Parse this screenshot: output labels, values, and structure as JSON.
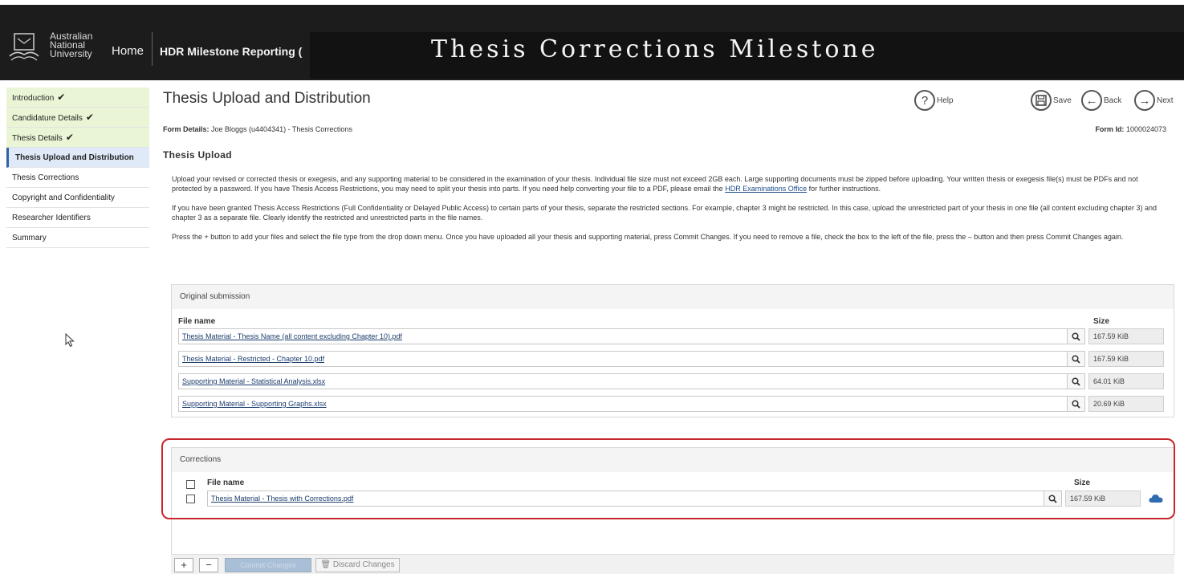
{
  "header": {
    "logo_lines": [
      "Australian",
      "National",
      "University"
    ],
    "home": "Home",
    "hdr": "HDR Milestone Reporting (",
    "banner": "Thesis Corrections Milestone"
  },
  "sidebar": {
    "items": [
      {
        "label": "Introduction",
        "status": "done"
      },
      {
        "label": "Candidature Details",
        "status": "done"
      },
      {
        "label": "Thesis Details",
        "status": "done"
      },
      {
        "label": "Thesis Upload and Distribution",
        "status": "active"
      },
      {
        "label": "Thesis Corrections",
        "status": ""
      },
      {
        "label": "Copyright and Confidentiality",
        "status": ""
      },
      {
        "label": "Researcher Identifiers",
        "status": ""
      },
      {
        "label": "Summary",
        "status": ""
      }
    ],
    "check_glyph": "✔"
  },
  "main": {
    "title": "Thesis Upload and Distribution",
    "form_details_label": "Form Details:",
    "form_details_value": " Joe Bloggs (u4404341) - Thesis Corrections",
    "form_id_label": "Form Id:",
    "form_id_value": " 1000024073",
    "section_title": "Thesis Upload",
    "toolbar": {
      "help": "Help",
      "save": "Save",
      "back": "Back",
      "next": "Next"
    },
    "para1_a": "Upload your revised or corrected thesis or exegesis, and any supporting material to be considered in the examination of your thesis. Individual file size must not exceed 2GB each. Large supporting documents must be zipped before uploading. Your written thesis or exegesis file(s) must be PDFs and not protected by a password. If you have Thesis Access Restrictions, you may need to split your thesis into parts. If you need help converting your file to a PDF, please email the ",
    "para1_link": "HDR Examinations Office",
    "para1_b": " for further instructions.",
    "para2": "If you have been granted Thesis Access Restrictions (Full Confidentiality or Delayed Public Access) to certain parts of your thesis, separate the restricted sections. For example, chapter 3 might be restricted. In this case, upload the unrestricted part of your thesis in one file (all content excluding chapter 3) and chapter 3 as a separate file. Clearly identify the restricted and unrestricted parts in the file names.",
    "para3": "Press the + button to add your files and select the file type from the drop down menu. Once you have uploaded all your thesis and supporting material, press Commit Changes. If you need to remove a file, check the box to the left of the file, press the – button and then press Commit Changes again."
  },
  "original": {
    "heading": "Original submission",
    "col_file": "File name",
    "col_size": "Size",
    "files": [
      {
        "name": "Thesis Material - Thesis Name (all content excluding Chapter 10).pdf",
        "size": "167.59 KiB"
      },
      {
        "name": "Thesis Material - Restricted - Chapter 10.pdf",
        "size": "167.59 KiB"
      },
      {
        "name": "Supporting Material - Statistical Analysis.xlsx",
        "size": "64.01 KiB"
      },
      {
        "name": "Supporting Material - Supporting Graphs.xlsx",
        "size": "20.69 KiB"
      }
    ]
  },
  "corrections": {
    "heading": "Corrections",
    "col_file": "File name",
    "col_size": "Size",
    "files": [
      {
        "name": "Thesis Material - Thesis with Corrections.pdf",
        "size": "167.59 KiB"
      }
    ]
  },
  "bottom": {
    "add": "+",
    "remove": "−",
    "commit": "Commit Changes",
    "discard": "Discard Changes"
  },
  "colors": {
    "header_bg": "#1c1c1c",
    "highlight": "#c8262c",
    "done_bg": "#eaf5d6",
    "upload_cloud": "#2f6db0"
  }
}
